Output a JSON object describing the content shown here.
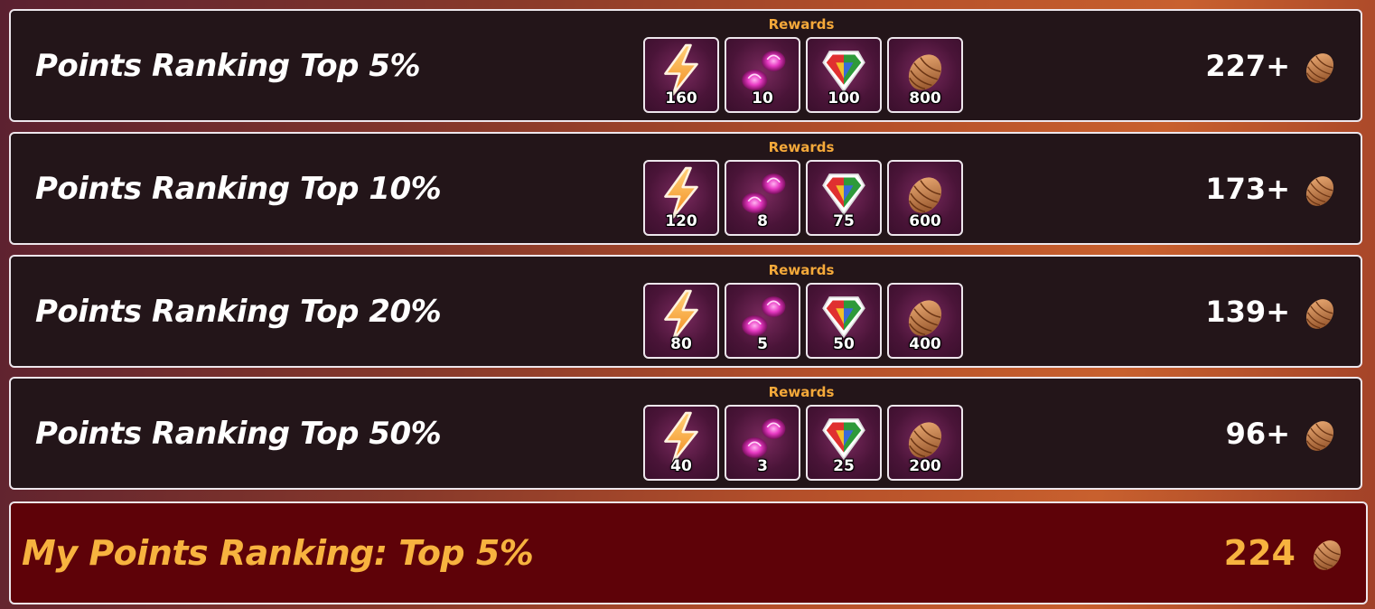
{
  "tiers": [
    {
      "title": "Points Ranking Top 5%",
      "rewards_label": "Rewards",
      "rewards": [
        "160",
        "10",
        "100",
        "800"
      ],
      "threshold": "227+"
    },
    {
      "title": "Points Ranking Top 10%",
      "rewards_label": "Rewards",
      "rewards": [
        "120",
        "8",
        "75",
        "600"
      ],
      "threshold": "173+"
    },
    {
      "title": "Points Ranking Top 20%",
      "rewards_label": "Rewards",
      "rewards": [
        "80",
        "5",
        "50",
        "400"
      ],
      "threshold": "139+"
    },
    {
      "title": "Points Ranking Top 50%",
      "rewards_label": "Rewards",
      "rewards": [
        "40",
        "3",
        "25",
        "200"
      ],
      "threshold": "96+"
    }
  ],
  "reward_icons": [
    "lightning-icon",
    "pink-crystal-icon",
    "rainbow-gem-icon",
    "pinecone-icon"
  ],
  "my_ranking": {
    "title": "My Points Ranking: Top 5%",
    "score": "224"
  },
  "colors": {
    "accent": "#f7b33f",
    "rewards_label": "#f5a93a",
    "row_bg": "#231519",
    "my_row_bg": "#5e0208"
  }
}
